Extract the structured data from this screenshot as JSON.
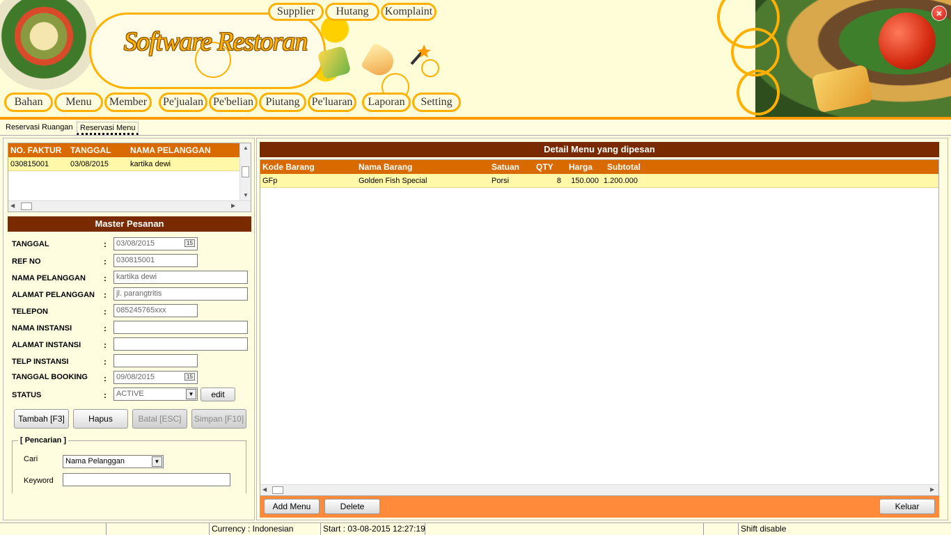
{
  "app": {
    "title": "Software Restoran"
  },
  "top_nav": [
    "Supplier",
    "Hutang",
    "Komplaint"
  ],
  "main_nav": [
    "Bahan",
    "Menu",
    "Member",
    "Pe'jualan",
    "Pe'belian",
    "Piutang",
    "Pe'luaran",
    "Laporan",
    "Setting"
  ],
  "tabs": [
    {
      "label": "Reservasi Ruangan",
      "active": false
    },
    {
      "label": "Reservasi Menu",
      "active": true
    }
  ],
  "faktur_grid": {
    "headers": [
      "NO. FAKTUR",
      "TANGGAL",
      "NAMA PELANGGAN"
    ],
    "rows": [
      [
        "030815001",
        "03/08/2015",
        "kartika dewi"
      ]
    ]
  },
  "master": {
    "title": "Master Pesanan",
    "fields": [
      {
        "label": "TANGGAL",
        "value": "03/08/2015"
      },
      {
        "label": "REF NO",
        "value": "030815001"
      },
      {
        "label": "NAMA PELANGGAN",
        "value": "kartika dewi"
      },
      {
        "label": "ALAMAT PELANGGAN",
        "value": "jl. parangtritis"
      },
      {
        "label": "TELEPON",
        "value": "085245765xxx"
      },
      {
        "label": "NAMA INSTANSI",
        "value": ""
      },
      {
        "label": "ALAMAT INSTANSI",
        "value": ""
      },
      {
        "label": "TELP INSTANSI",
        "value": ""
      },
      {
        "label": "TANGGAL BOOKING",
        "value": "09/08/2015"
      },
      {
        "label": "STATUS",
        "value": "ACTIVE"
      }
    ],
    "colon": ":",
    "calendar_glyph": "15",
    "edit_label": "edit"
  },
  "actions": [
    "Tambah [F3]",
    "Hapus",
    "Batal [ESC]",
    "Simpan [F10]"
  ],
  "search": {
    "legend": "[ Pencarian ]",
    "cari_label": "Cari",
    "cari_value": "Nama Pelanggan",
    "keyword_label": "Keyword",
    "keyword_value": ""
  },
  "detail": {
    "title": "Detail Menu yang dipesan",
    "headers": [
      "Kode Barang",
      "Nama Barang",
      "Satuan",
      "QTY",
      "Harga",
      "Subtotal"
    ],
    "rows": [
      [
        "GFp",
        "Golden Fish Special",
        "Porsi",
        "8",
        "150.000",
        "1.200.000"
      ]
    ]
  },
  "detail_actions": {
    "add": "Add Menu",
    "delete": "Delete",
    "exit": "Keluar"
  },
  "statusbar": {
    "currency": "Currency : Indonesian",
    "start": "Start  : 03-08-2015 12:27:19",
    "shift": "Shift disable"
  },
  "colors": {
    "accent": "#ffb000",
    "header_dark": "#7a2a00",
    "grid_header": "#d96a00",
    "row_highlight": "#fff8a8"
  }
}
